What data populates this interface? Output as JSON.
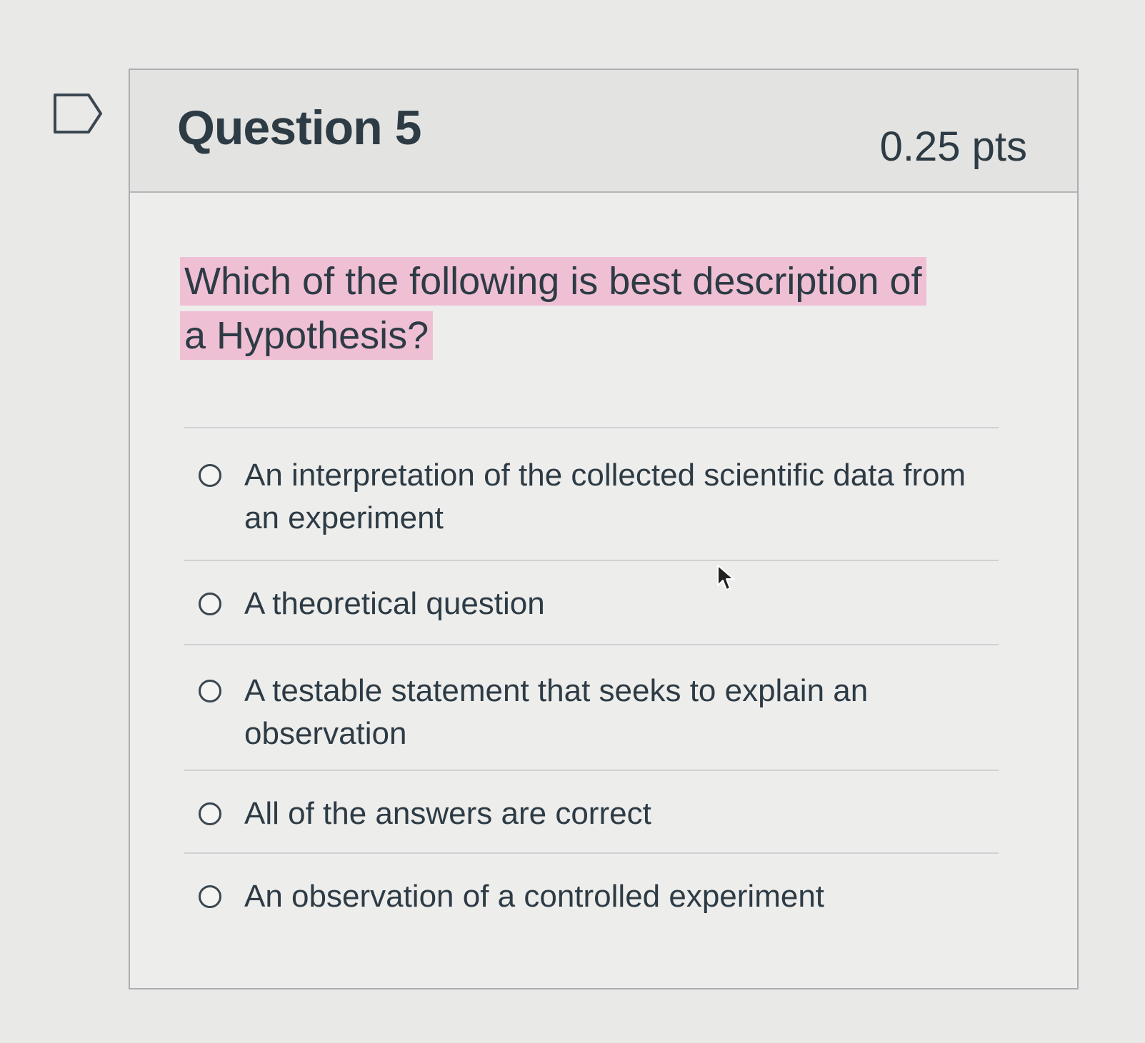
{
  "question": {
    "flag_icon": "flag-outline-icon",
    "title": "Question 5",
    "points": "0.25 pts",
    "text": "Which of the following is best description of a Hypothesis?",
    "highlight_color": "#efbfd4",
    "answers": [
      {
        "label": "An interpretation of the collected scientific data from an experiment",
        "selected": false
      },
      {
        "label": "A theoretical question",
        "selected": false
      },
      {
        "label": "A testable statement that seeks to explain an observation",
        "selected": false
      },
      {
        "label": "All of the answers are correct",
        "selected": false
      },
      {
        "label": "An observation of a controlled experiment",
        "selected": false
      }
    ]
  },
  "cursor_icon": "mouse-pointer-icon"
}
